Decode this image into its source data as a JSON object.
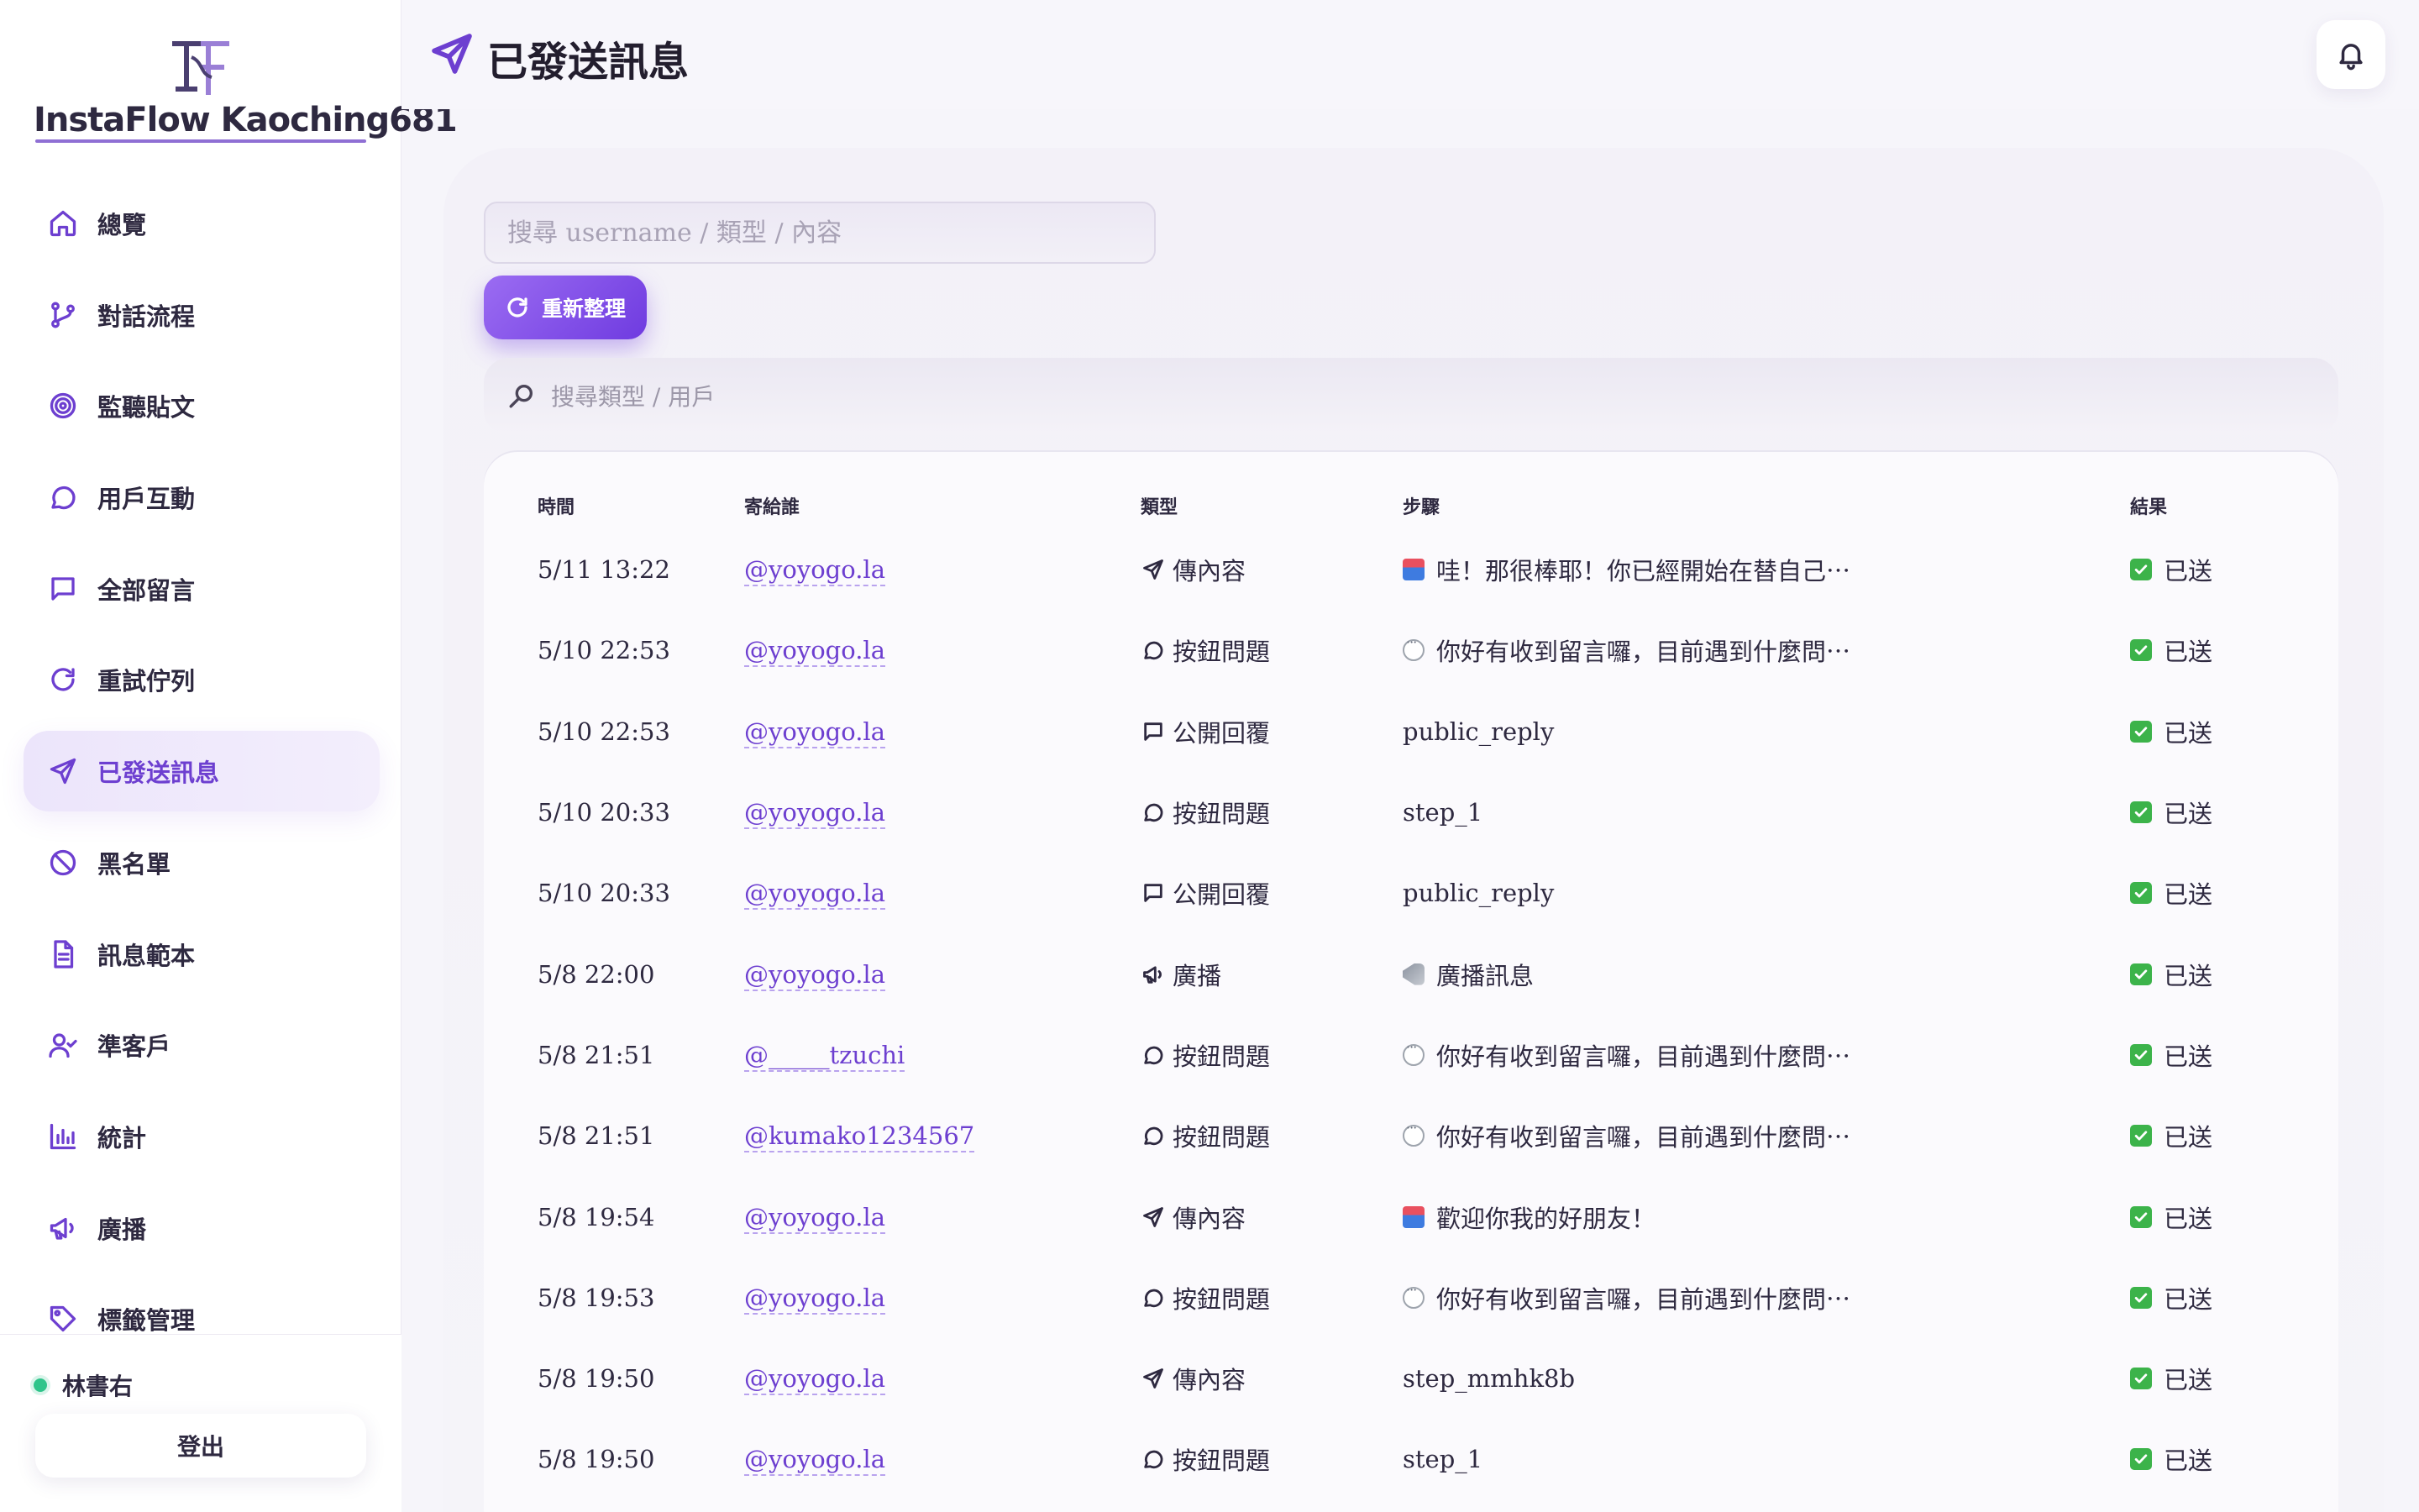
{
  "brand": {
    "name": "InstaFlow Kaoching681"
  },
  "nav": {
    "items": [
      {
        "label": "總覽",
        "icon": "home-icon"
      },
      {
        "label": "對話流程",
        "icon": "git-branch-icon"
      },
      {
        "label": "監聽貼文",
        "icon": "target-icon"
      },
      {
        "label": "用戶互動",
        "icon": "chat-bubble-icon"
      },
      {
        "label": "全部留言",
        "icon": "message-square-icon"
      },
      {
        "label": "重試佇列",
        "icon": "refresh-icon"
      },
      {
        "label": "已發送訊息",
        "icon": "send-icon",
        "active": true
      },
      {
        "label": "黑名單",
        "icon": "block-icon"
      },
      {
        "label": "訊息範本",
        "icon": "document-icon"
      },
      {
        "label": "準客戶",
        "icon": "user-check-icon"
      },
      {
        "label": "統計",
        "icon": "bar-chart-icon"
      },
      {
        "label": "廣播",
        "icon": "megaphone-icon"
      },
      {
        "label": "標籤管理",
        "icon": "tag-icon"
      }
    ]
  },
  "user": {
    "name": "林書右",
    "status": "online"
  },
  "logout_label": "登出",
  "header": {
    "title": "已發送訊息"
  },
  "search": {
    "placeholder": "搜尋 username / 類型 / 內容",
    "value": ""
  },
  "refresh_label": "重新整理",
  "filter": {
    "placeholder": "搜尋類型 / 用戶",
    "value": ""
  },
  "table": {
    "headers": {
      "time": "時間",
      "to": "寄給誰",
      "type": "類型",
      "step": "步驟",
      "result": "結果"
    },
    "rows": [
      {
        "time": "5/11 13:22",
        "to": "@yoyogo.la",
        "type": "傳內容",
        "type_icon": "send-icon",
        "step_emoji": "inbox",
        "step": "哇！那很棒耶！你已經開始在替自己⋯",
        "result": "已送"
      },
      {
        "time": "5/10 22:53",
        "to": "@yoyogo.la",
        "type": "按鈕問題",
        "type_icon": "chat-bubble-icon",
        "step_emoji": "bubble",
        "step": "你好有收到留言囉，目前遇到什麼問⋯",
        "result": "已送"
      },
      {
        "time": "5/10 22:53",
        "to": "@yoyogo.la",
        "type": "公開回覆",
        "type_icon": "message-square-icon",
        "step_emoji": "",
        "step": "public_reply",
        "result": "已送"
      },
      {
        "time": "5/10 20:33",
        "to": "@yoyogo.la",
        "type": "按鈕問題",
        "type_icon": "chat-bubble-icon",
        "step_emoji": "",
        "step": "step_1",
        "result": "已送"
      },
      {
        "time": "5/10 20:33",
        "to": "@yoyogo.la",
        "type": "公開回覆",
        "type_icon": "message-square-icon",
        "step_emoji": "",
        "step": "public_reply",
        "result": "已送"
      },
      {
        "time": "5/8 22:00",
        "to": "@yoyogo.la",
        "type": "廣播",
        "type_icon": "megaphone-icon",
        "step_emoji": "horn",
        "step": "廣播訊息",
        "result": "已送"
      },
      {
        "time": "5/8 21:51",
        "to": "@_____tzuchi",
        "type": "按鈕問題",
        "type_icon": "chat-bubble-icon",
        "step_emoji": "bubble",
        "step": "你好有收到留言囉，目前遇到什麼問⋯",
        "result": "已送"
      },
      {
        "time": "5/8 21:51",
        "to": "@kumako1234567",
        "type": "按鈕問題",
        "type_icon": "chat-bubble-icon",
        "step_emoji": "bubble",
        "step": "你好有收到留言囉，目前遇到什麼問⋯",
        "result": "已送"
      },
      {
        "time": "5/8 19:54",
        "to": "@yoyogo.la",
        "type": "傳內容",
        "type_icon": "send-icon",
        "step_emoji": "inbox",
        "step": "歡迎你我的好朋友！",
        "result": "已送"
      },
      {
        "time": "5/8 19:53",
        "to": "@yoyogo.la",
        "type": "按鈕問題",
        "type_icon": "chat-bubble-icon",
        "step_emoji": "bubble",
        "step": "你好有收到留言囉，目前遇到什麼問⋯",
        "result": "已送"
      },
      {
        "time": "5/8 19:50",
        "to": "@yoyogo.la",
        "type": "傳內容",
        "type_icon": "send-icon",
        "step_emoji": "",
        "step": "step_mmhk8b",
        "result": "已送"
      },
      {
        "time": "5/8 19:50",
        "to": "@yoyogo.la",
        "type": "按鈕問題",
        "type_icon": "chat-bubble-icon",
        "step_emoji": "",
        "step": "step_1",
        "result": "已送"
      }
    ]
  },
  "colors": {
    "accent": "#6d3fd0",
    "accent_light": "#ece5fb",
    "success": "#3cb34a",
    "online": "#2fc48a"
  }
}
